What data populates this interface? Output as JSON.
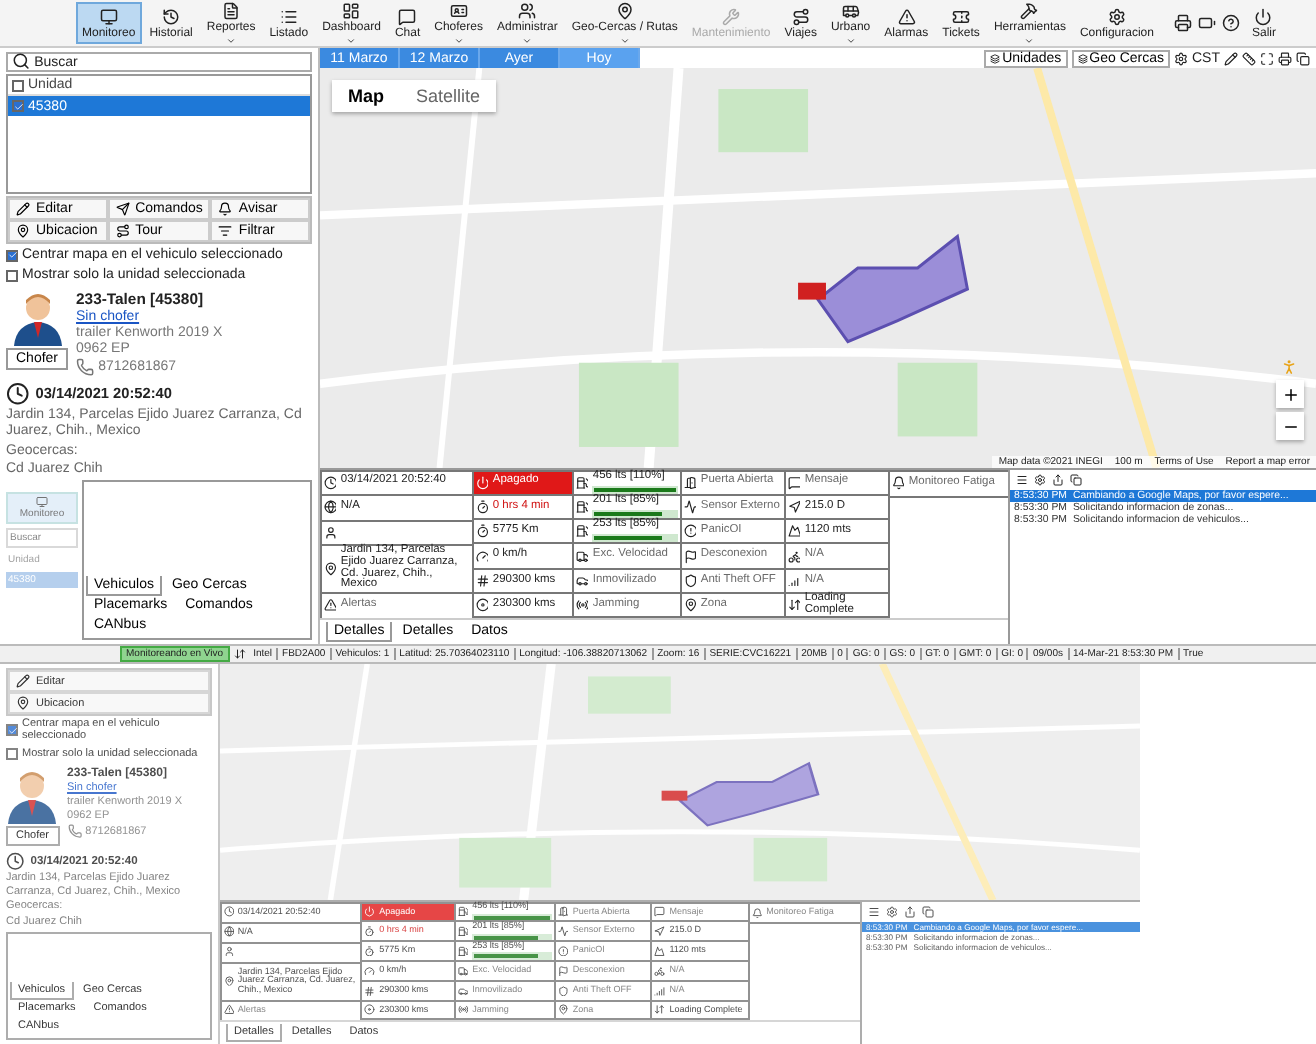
{
  "toolbar": {
    "items": [
      {
        "label": "Monitoreo",
        "selected": true,
        "dropdown": false,
        "disabled": false
      },
      {
        "label": "Historial",
        "selected": false,
        "dropdown": false,
        "disabled": false
      },
      {
        "label": "Reportes",
        "selected": false,
        "dropdown": true,
        "disabled": false
      },
      {
        "label": "Listado",
        "selected": false,
        "dropdown": false,
        "disabled": false
      },
      {
        "label": "Dashboard",
        "selected": false,
        "dropdown": true,
        "disabled": false
      },
      {
        "label": "Chat",
        "selected": false,
        "dropdown": false,
        "disabled": false
      },
      {
        "label": "Choferes",
        "selected": false,
        "dropdown": true,
        "disabled": false
      },
      {
        "label": "Administrar",
        "selected": false,
        "dropdown": true,
        "disabled": false
      },
      {
        "label": "Geo-Cercas / Rutas",
        "selected": false,
        "dropdown": true,
        "disabled": false
      },
      {
        "label": "Mantenimiento",
        "selected": false,
        "dropdown": false,
        "disabled": true
      },
      {
        "label": "Viajes",
        "selected": false,
        "dropdown": false,
        "disabled": false
      },
      {
        "label": "Urbano",
        "selected": false,
        "dropdown": true,
        "disabled": false
      },
      {
        "label": "Alarmas",
        "selected": false,
        "dropdown": false,
        "disabled": false
      },
      {
        "label": "Tickets",
        "selected": false,
        "dropdown": false,
        "disabled": false
      },
      {
        "label": "Herramientas",
        "selected": false,
        "dropdown": true,
        "disabled": false
      },
      {
        "label": "Configuracion",
        "selected": false,
        "dropdown": false,
        "disabled": false
      }
    ],
    "exit": "Salir"
  },
  "units": {
    "search_label": "Buscar",
    "column": "Unidad",
    "header_checked": false,
    "rows": [
      {
        "label": "45380",
        "checked": true,
        "selected": true
      }
    ]
  },
  "actions": [
    "Editar",
    "Comandos",
    "Avisar",
    "Ubicacion",
    "Tour",
    "Filtrar"
  ],
  "options": [
    {
      "label": "Centrar mapa en el vehiculo seleccionado",
      "checked": true
    },
    {
      "label": "Mostrar solo la unidad seleccionada",
      "checked": false
    }
  ],
  "vehicle": {
    "name": "233-Talen [45380]",
    "driver": "Sin chofer",
    "model": "trailer Kenworth 2019 X",
    "plate": "0962 EP",
    "phone": "8712681867",
    "driver_button": "Chofer",
    "date": "03/14/2021 20:52:40",
    "address": "Jardin 134, Parcelas Ejido Juarez Carranza, Cd Juarez, Chih., Mexico",
    "geofence_label": "Geocercas:",
    "geofence": "Cd Juarez Chih"
  },
  "mini": {
    "button": "Monitoreo",
    "search": "Buscar",
    "column": "Unidad",
    "row": "45380"
  },
  "left_tabs": [
    {
      "label": "Vehiculos",
      "selected": true
    },
    {
      "label": "Geo Cercas",
      "selected": false
    },
    {
      "label": "Placemarks",
      "selected": false
    },
    {
      "label": "Comandos",
      "selected": false
    },
    {
      "label": "CANbus",
      "selected": false
    }
  ],
  "map": {
    "date_tabs": [
      {
        "label": "11 Marzo",
        "selected": false
      },
      {
        "label": "12 Marzo",
        "selected": false
      },
      {
        "label": "Ayer",
        "selected": false
      },
      {
        "label": "Hoy",
        "selected": true
      }
    ],
    "layer_buttons": [
      "Unidades",
      "Geo Cercas"
    ],
    "time_zone": "CST",
    "map_types": [
      {
        "label": "Map",
        "selected": true
      },
      {
        "label": "Satellite",
        "selected": false
      }
    ],
    "attribution": [
      "Map data ©2021 INEGI",
      "100 m",
      "Terms of Use",
      "Report a map error"
    ]
  },
  "details": {
    "columns": [
      [
        {
          "kind": "plain",
          "text": "03/14/2021 20:52:40"
        },
        {
          "kind": "plain",
          "text": "N/A"
        },
        {
          "kind": "plain"
        },
        {
          "kind": "address",
          "text": "Jardin 134, Parcelas Ejido Juarez Carranza, Cd. Juarez, Chih., Mexico"
        },
        {
          "kind": "muted",
          "text": "Alertas"
        }
      ],
      [
        {
          "kind": "alarm",
          "text": "Apagado"
        },
        {
          "kind": "warn",
          "text": "0 hrs 4 min"
        },
        {
          "kind": "plain",
          "text": "5775 Km"
        },
        {
          "kind": "plain",
          "text": "0 km/h"
        },
        {
          "kind": "plain",
          "text": "290300 kms"
        },
        {
          "kind": "plain",
          "text": "230300 kms"
        }
      ],
      [
        {
          "kind": "fuel",
          "text": "456 lts [110%]",
          "level": 1
        },
        {
          "kind": "fuel",
          "text": "201 lts [85%]",
          "level": 0.85
        },
        {
          "kind": "fuel",
          "text": "253 lts [85%]",
          "level": 0.85
        },
        {
          "kind": "muted",
          "text": "Exc. Velocidad"
        },
        {
          "kind": "muted",
          "text": "Inmovilizado"
        },
        {
          "kind": "muted",
          "text": "Jamming"
        }
      ],
      [
        {
          "kind": "muted",
          "text": "Puerta Abierta"
        },
        {
          "kind": "muted",
          "text": "Sensor Externo"
        },
        {
          "kind": "muted",
          "text": "PanicOI"
        },
        {
          "kind": "muted",
          "text": "Desconexion"
        },
        {
          "kind": "muted",
          "text": "Anti Theft OFF"
        },
        {
          "kind": "muted",
          "text": "Zona"
        }
      ],
      [
        {
          "kind": "muted",
          "text": "Mensaje"
        },
        {
          "kind": "plain",
          "text": "215.0 D"
        },
        {
          "kind": "plain",
          "text": "1120 mts"
        },
        {
          "kind": "muted",
          "text": "N/A"
        },
        {
          "kind": "muted",
          "text": "N/A"
        },
        {
          "kind": "plain",
          "text": "Loading Complete"
        }
      ],
      [
        {
          "kind": "muted",
          "text": "Monitoreo Fatiga"
        }
      ]
    ]
  },
  "detail_tabs": [
    {
      "label": "Detalles",
      "selected": true
    },
    {
      "label": "Detalles",
      "selected": false
    },
    {
      "label": "Datos",
      "selected": false
    }
  ],
  "log": {
    "entries": [
      {
        "time": "8:53:30 PM",
        "message": "Cambiando a Google Maps, por favor espere...",
        "selected": true
      },
      {
        "time": "8:53:30 PM",
        "message": "Solicitando informacion de zonas...",
        "selected": false
      },
      {
        "time": "8:53:30 PM",
        "message": "Solicitando informacion de vehiculos...",
        "selected": false
      }
    ]
  },
  "status_bar": {
    "mode": "Monitoreando en Vivo",
    "segments": [
      "Intel",
      "FBD2A00",
      "Vehiculos: 1",
      "Latitud: 25.70364023110",
      "Longitud: -106.38820713062",
      "Zoom: 16",
      "SERIE:CVC16221",
      "20MB",
      "0",
      "GG: 0",
      "GS: 0",
      "GT: 0",
      "GMT: 0",
      "GI: 0",
      "09/00s",
      "14-Mar-21 8:53:30 PM",
      "True"
    ]
  },
  "ghost": {
    "actions": [
      "Editar",
      "Ubicacion"
    ],
    "options": [
      {
        "label": "Centrar mapa en el vehiculo seleccionado",
        "checked": true
      },
      {
        "label": "Mostrar solo la unidad seleccionada",
        "checked": false
      }
    ],
    "vehicle": {
      "name": "233-Talen [45380]",
      "driver": "Sin chofer",
      "model": "trailer Kenworth 2019 X",
      "plate": "0962 EP",
      "phone": "8712681867",
      "driver_button": "Chofer",
      "date": "03/14/2021 20:52:40",
      "address": "Jardin 134, Parcelas Ejido Juarez Carranza, Cd Juarez, Chih., Mexico",
      "geofence_label": "Geocercas:",
      "geofence": "Cd Juarez Chih"
    },
    "left_tabs": [
      {
        "label": "Vehiculos",
        "selected": true
      },
      {
        "label": "Geo Cercas",
        "selected": false
      },
      {
        "label": "Placemarks",
        "selected": false
      },
      {
        "label": "Comandos",
        "selected": false
      },
      {
        "label": "CANbus",
        "selected": false
      }
    ],
    "details": {
      "columns": [
        [
          {
            "kind": "plain",
            "text": "03/14/2021 20:52:40"
          },
          {
            "kind": "plain",
            "text": "N/A"
          },
          {
            "kind": "plain"
          },
          {
            "kind": "address",
            "text": "Jardin 134, Parcelas Ejido Juarez Carranza, Cd. Juarez, Chih., Mexico"
          },
          {
            "kind": "muted",
            "text": "Alertas"
          }
        ],
        [
          {
            "kind": "alarm",
            "text": "Apagado"
          },
          {
            "kind": "warn",
            "text": "0 hrs 4 min"
          },
          {
            "kind": "plain",
            "text": "5775 Km"
          },
          {
            "kind": "plain",
            "text": "0 km/h"
          },
          {
            "kind": "plain",
            "text": "290300 kms"
          },
          {
            "kind": "plain",
            "text": "230300 kms"
          }
        ],
        [
          {
            "kind": "fuel",
            "text": "456 lts [110%]",
            "level": 1
          },
          {
            "kind": "fuel",
            "text": "201 lts [85%]",
            "level": 0.85
          },
          {
            "kind": "fuel",
            "text": "253 lts [85%]",
            "level": 0.85
          },
          {
            "kind": "muted",
            "text": "Exc. Velocidad"
          },
          {
            "kind": "muted",
            "text": "Inmovilizado"
          },
          {
            "kind": "muted",
            "text": "Jamming"
          }
        ],
        [
          {
            "kind": "muted",
            "text": "Puerta Abierta"
          },
          {
            "kind": "muted",
            "text": "Sensor Externo"
          },
          {
            "kind": "muted",
            "text": "PanicOI"
          },
          {
            "kind": "muted",
            "text": "Desconexion"
          },
          {
            "kind": "muted",
            "text": "Anti Theft OFF"
          },
          {
            "kind": "muted",
            "text": "Zona"
          }
        ],
        [
          {
            "kind": "muted",
            "text": "Mensaje"
          },
          {
            "kind": "plain",
            "text": "215.0 D"
          },
          {
            "kind": "plain",
            "text": "1120 mts"
          },
          {
            "kind": "muted",
            "text": "N/A"
          },
          {
            "kind": "muted",
            "text": "N/A"
          },
          {
            "kind": "plain",
            "text": "Loading Complete"
          }
        ],
        [
          {
            "kind": "muted",
            "text": "Monitoreo Fatiga"
          }
        ]
      ]
    },
    "detail_tabs": [
      {
        "label": "Detalles",
        "selected": true
      },
      {
        "label": "Detalles",
        "selected": false
      },
      {
        "label": "Datos",
        "selected": false
      }
    ],
    "log": {
      "entries": [
        {
          "time": "8:53:30 PM",
          "message": "Cambiando a Google Maps, por favor espere...",
          "selected": true
        },
        {
          "time": "8:53:30 PM",
          "message": "Solicitando informacion de zonas...",
          "selected": false
        },
        {
          "time": "8:53:30 PM",
          "message": "Solicitando informacion de vehiculos...",
          "selected": false
        }
      ]
    }
  }
}
